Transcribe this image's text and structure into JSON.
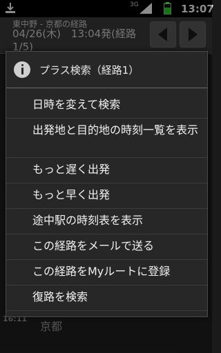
{
  "status_bar": {
    "network": "3G",
    "time": "13:07"
  },
  "header": {
    "route_title": "東中野 - 京都の経路",
    "route_detail": "04/26(木)　13:04発(経路1/5)"
  },
  "background": {
    "arrive_time": "16:11",
    "station": "京都"
  },
  "dialog": {
    "title": "プラス検索（経路1）",
    "items": [
      {
        "label": "日時を変えて検索"
      },
      {
        "label": "出発地と目的地の時刻一覧を表示"
      },
      {
        "label": "もっと遅く出発"
      },
      {
        "label": "もっと早く出発"
      },
      {
        "label": "途中駅の時刻表を表示"
      },
      {
        "label": "この経路をメールで送る"
      },
      {
        "label": "この経路をMyルートに登録"
      },
      {
        "label": "復路を検索"
      }
    ]
  }
}
